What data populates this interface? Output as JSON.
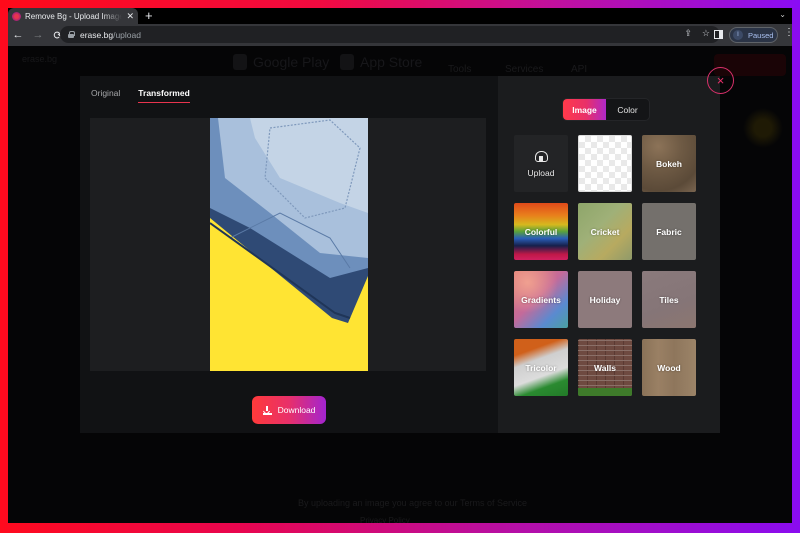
{
  "browser": {
    "tab": {
      "title": "Remove Bg - Upload Images to Remove Background",
      "favicon": "erase-bg-favicon"
    },
    "new_tab_label": "+",
    "tabs_menu_icon": "chevron-down-icon",
    "nav": {
      "back": "←",
      "forward": "→",
      "reload": "⟳"
    },
    "url": {
      "domain": "erase.bg",
      "path": "/upload"
    },
    "omnibox_icons": {
      "share": "⇪",
      "bookmark": "☆"
    },
    "profile": {
      "initial": "I",
      "label": "Paused"
    },
    "menu": "⋮"
  },
  "background_page": {
    "logo": "erase.bg",
    "stores": [
      "Google Play",
      "App Store"
    ],
    "nav_items": [
      "Tools",
      "Services",
      "API"
    ],
    "footer_text": "By uploading an image you agree to our Terms of Service",
    "footer_link": "Privacy Policy"
  },
  "modal": {
    "preview_tabs": [
      {
        "label": "Original",
        "active": false
      },
      {
        "label": "Transformed",
        "active": true
      }
    ],
    "download_label": "Download",
    "close_icon": "×",
    "background_mode": [
      {
        "label": "Image",
        "active": true
      },
      {
        "label": "Color",
        "active": false
      }
    ],
    "backgrounds": [
      {
        "label": "Upload",
        "kind": "upload"
      },
      {
        "label": "",
        "kind": "transparent"
      },
      {
        "label": "Bokeh",
        "kind": "bokeh"
      },
      {
        "label": "Colorful",
        "kind": "colorful"
      },
      {
        "label": "Cricket",
        "kind": "cricket"
      },
      {
        "label": "Fabric",
        "kind": "fabric"
      },
      {
        "label": "Gradients",
        "kind": "gradients"
      },
      {
        "label": "Holiday",
        "kind": "holiday"
      },
      {
        "label": "Tiles",
        "kind": "tiles"
      },
      {
        "label": "Tricolor",
        "kind": "tricolor"
      },
      {
        "label": "Walls",
        "kind": "walls"
      },
      {
        "label": "Wood",
        "kind": "wood"
      }
    ],
    "preview_background_color": "#ffe433"
  },
  "colors": {
    "accent_start": "#ff3a3a",
    "accent_end": "#a324d0",
    "frame_left": "#ff0a1e",
    "frame_right": "#8a0cf0"
  }
}
